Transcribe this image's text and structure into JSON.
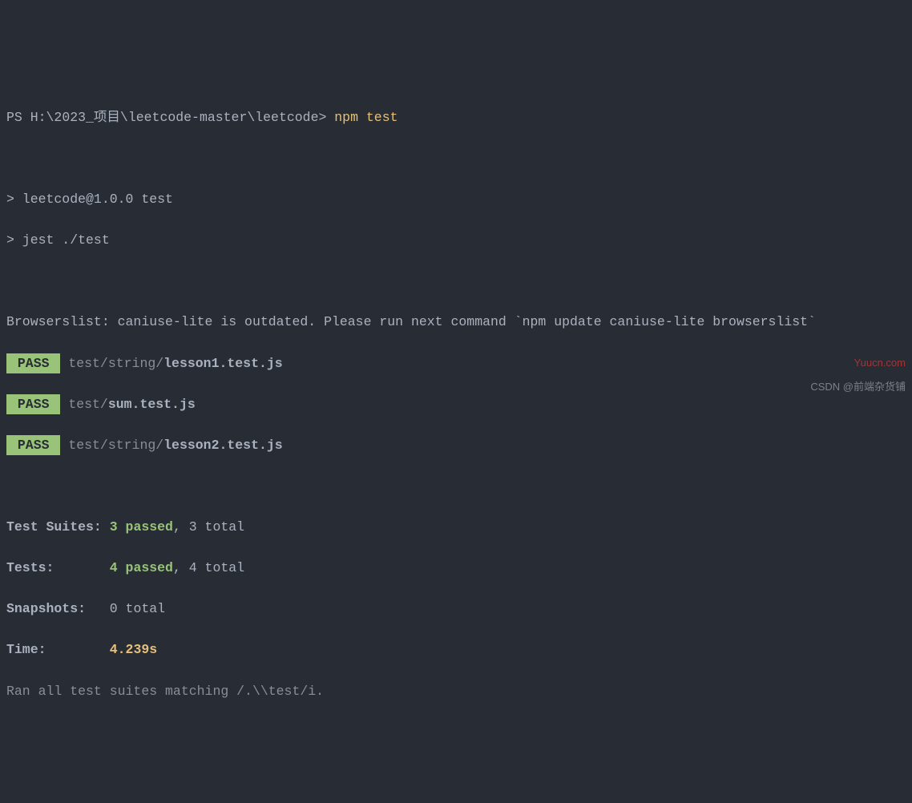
{
  "prompt": {
    "prefix": "PS ",
    "path": "H:\\2023_项目\\leetcode-master\\leetcode> ",
    "command": "npm test"
  },
  "script_lines": [
    "> leetcode@1.0.0 test",
    "> jest ./test"
  ],
  "warning": "Browserslist: caniuse-lite is outdated. Please run next command `npm update caniuse-lite browserslist`",
  "pass_badge": " PASS ",
  "tests": [
    {
      "prefix": "test/string/",
      "file": "lesson1.test.js"
    },
    {
      "prefix": "test/",
      "file": "sum.test.js"
    },
    {
      "prefix": "test/string/",
      "file": "lesson2.test.js"
    }
  ],
  "summary": {
    "suites": {
      "label": "Test Suites: ",
      "passed": "3 passed",
      "rest": ", 3 total"
    },
    "tests": {
      "label": "Tests:       ",
      "passed": "4 passed",
      "rest": ", 4 total"
    },
    "snapshots": {
      "label": "Snapshots:   ",
      "value": "0 total"
    },
    "time": {
      "label": "Time:        ",
      "value": "4.239s"
    }
  },
  "footer": "Ran all test suites matching /.\\\\test/i.",
  "watermarks": {
    "top": "Yuucn.com",
    "bottom": "CSDN @前端杂货铺"
  }
}
